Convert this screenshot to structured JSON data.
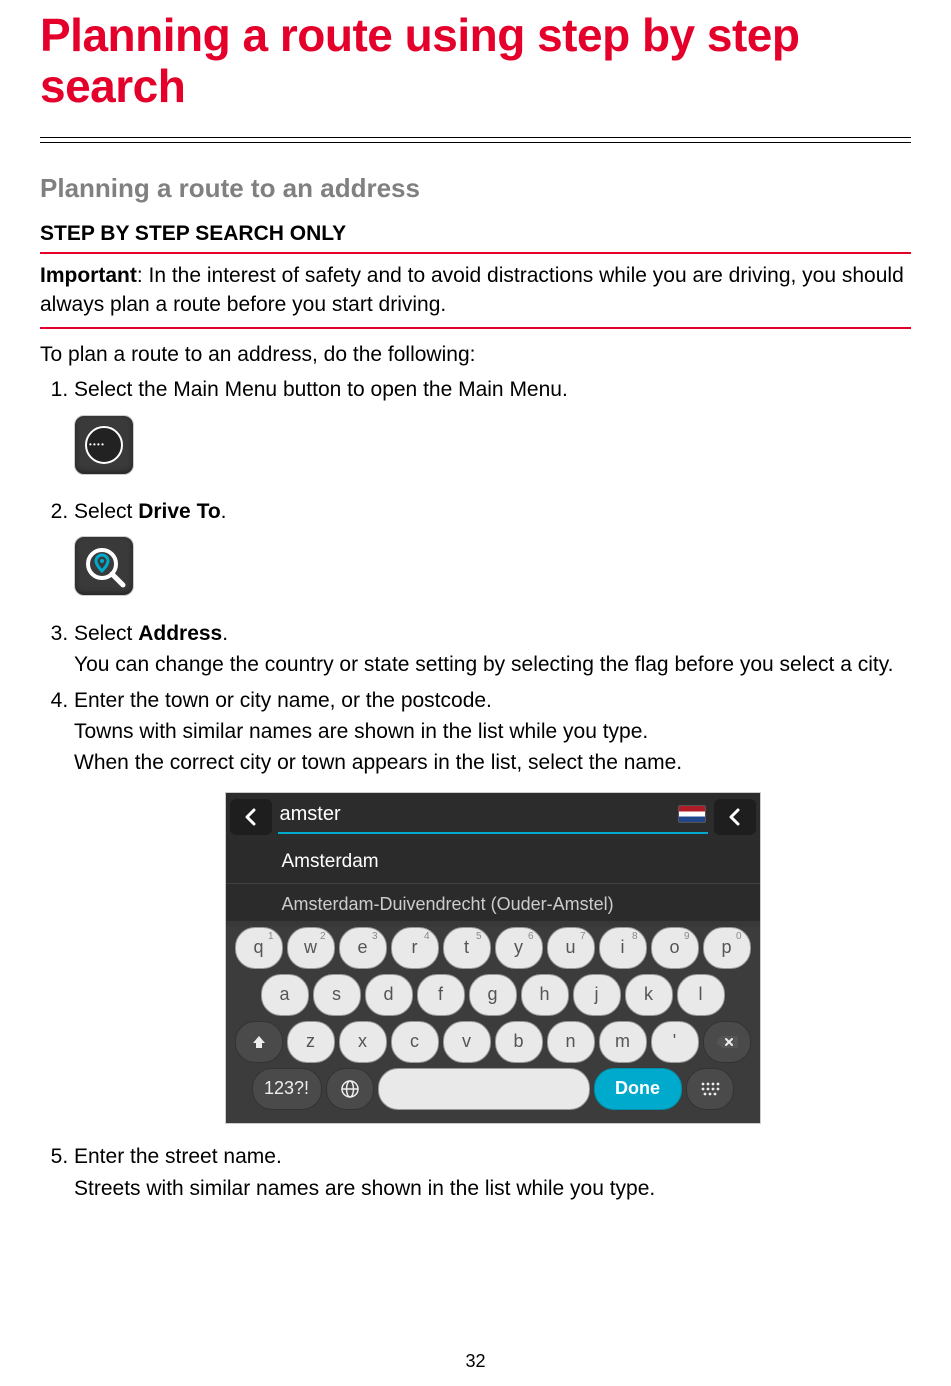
{
  "title": "Planning a route using step by step search",
  "section_heading": "Planning a route to an address",
  "step_mode": "STEP BY STEP SEARCH ONLY",
  "important_label": "Important",
  "important_text": ": In the interest of safety and to avoid distractions while you are driving, you should always plan a route before you start driving.",
  "intro_text": "To plan a route to an address, do the following:",
  "steps": {
    "s1": "Select the Main Menu button to open the Main Menu.",
    "s2_pre": "Select ",
    "s2_bold": "Drive To",
    "s2_post": ".",
    "s3_pre": "Select ",
    "s3_bold": "Address",
    "s3_post": ".",
    "s3_sub": "You can change the country or state setting by selecting the flag before you select a city.",
    "s4": "Enter the town or city name, or the postcode.",
    "s4_sub1": "Towns with similar names are shown in the list while you type.",
    "s4_sub2": "When the correct city or town appears in the list, select the name.",
    "s5": "Enter the street name.",
    "s5_sub": "Streets with similar names are shown in the list while you type."
  },
  "screenshot": {
    "search_value": "amster",
    "suggestions": [
      "Amsterdam",
      "Amsterdam-Duivendrecht (Ouder-Amstel)"
    ],
    "keyboard": {
      "row1": [
        {
          "k": "q",
          "n": "1"
        },
        {
          "k": "w",
          "n": "2"
        },
        {
          "k": "e",
          "n": "3"
        },
        {
          "k": "r",
          "n": "4"
        },
        {
          "k": "t",
          "n": "5"
        },
        {
          "k": "y",
          "n": "6"
        },
        {
          "k": "u",
          "n": "7"
        },
        {
          "k": "i",
          "n": "8"
        },
        {
          "k": "o",
          "n": "9"
        },
        {
          "k": "p",
          "n": "0"
        }
      ],
      "row2": [
        "a",
        "s",
        "d",
        "f",
        "g",
        "h",
        "j",
        "k",
        "l"
      ],
      "row3": [
        "z",
        "x",
        "c",
        "v",
        "b",
        "n",
        "m",
        "'"
      ],
      "mode_key": "123?!",
      "done_key": "Done"
    }
  },
  "page_number": "32"
}
